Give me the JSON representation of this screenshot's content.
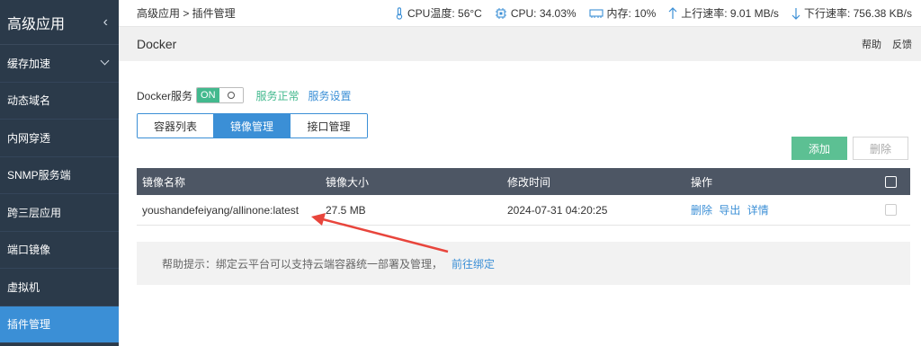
{
  "sidebar": {
    "title": "高级应用",
    "items": [
      {
        "label": "缓存加速"
      },
      {
        "label": "动态域名"
      },
      {
        "label": "内网穿透"
      },
      {
        "label": "SNMP服务端"
      },
      {
        "label": "跨三层应用"
      },
      {
        "label": "端口镜像"
      },
      {
        "label": "虚拟机"
      },
      {
        "label": "插件管理"
      }
    ]
  },
  "topbar": {
    "breadcrumb": "高级应用 > 插件管理",
    "cpu_temp": "CPU温度: 56°C",
    "cpu": "CPU: 34.03%",
    "memory": "内存: 10%",
    "upload": "上行速率: 9.01 MB/s",
    "download": "下行速率: 756.38 KB/s"
  },
  "page": {
    "title": "Docker",
    "help": "帮助",
    "feedback": "反馈"
  },
  "service": {
    "label": "Docker服务",
    "toggle_on": "ON",
    "status": "服务正常",
    "settings": "服务设置"
  },
  "tabs": [
    {
      "label": "容器列表"
    },
    {
      "label": "镜像管理"
    },
    {
      "label": "接口管理"
    }
  ],
  "actions": {
    "add": "添加",
    "delete": "删除"
  },
  "table": {
    "headers": [
      "镜像名称",
      "镜像大小",
      "修改时间",
      "操作"
    ],
    "rows": [
      {
        "name": "youshandefeiyang/allinone:latest",
        "size": "27.5 MB",
        "modified": "2024-07-31 04:20:25",
        "op_delete": "删除",
        "op_export": "导出",
        "op_detail": "详情"
      }
    ]
  },
  "help_tip": {
    "text": "帮助提示：绑定云平台可以支持云端容器统一部署及管理，",
    "link": "前往绑定"
  },
  "colors": {
    "sidebar_bg": "#2b3a4a",
    "active": "#3b8fd6",
    "success": "#43b98e",
    "annotation_arrow": "#e8453c"
  }
}
